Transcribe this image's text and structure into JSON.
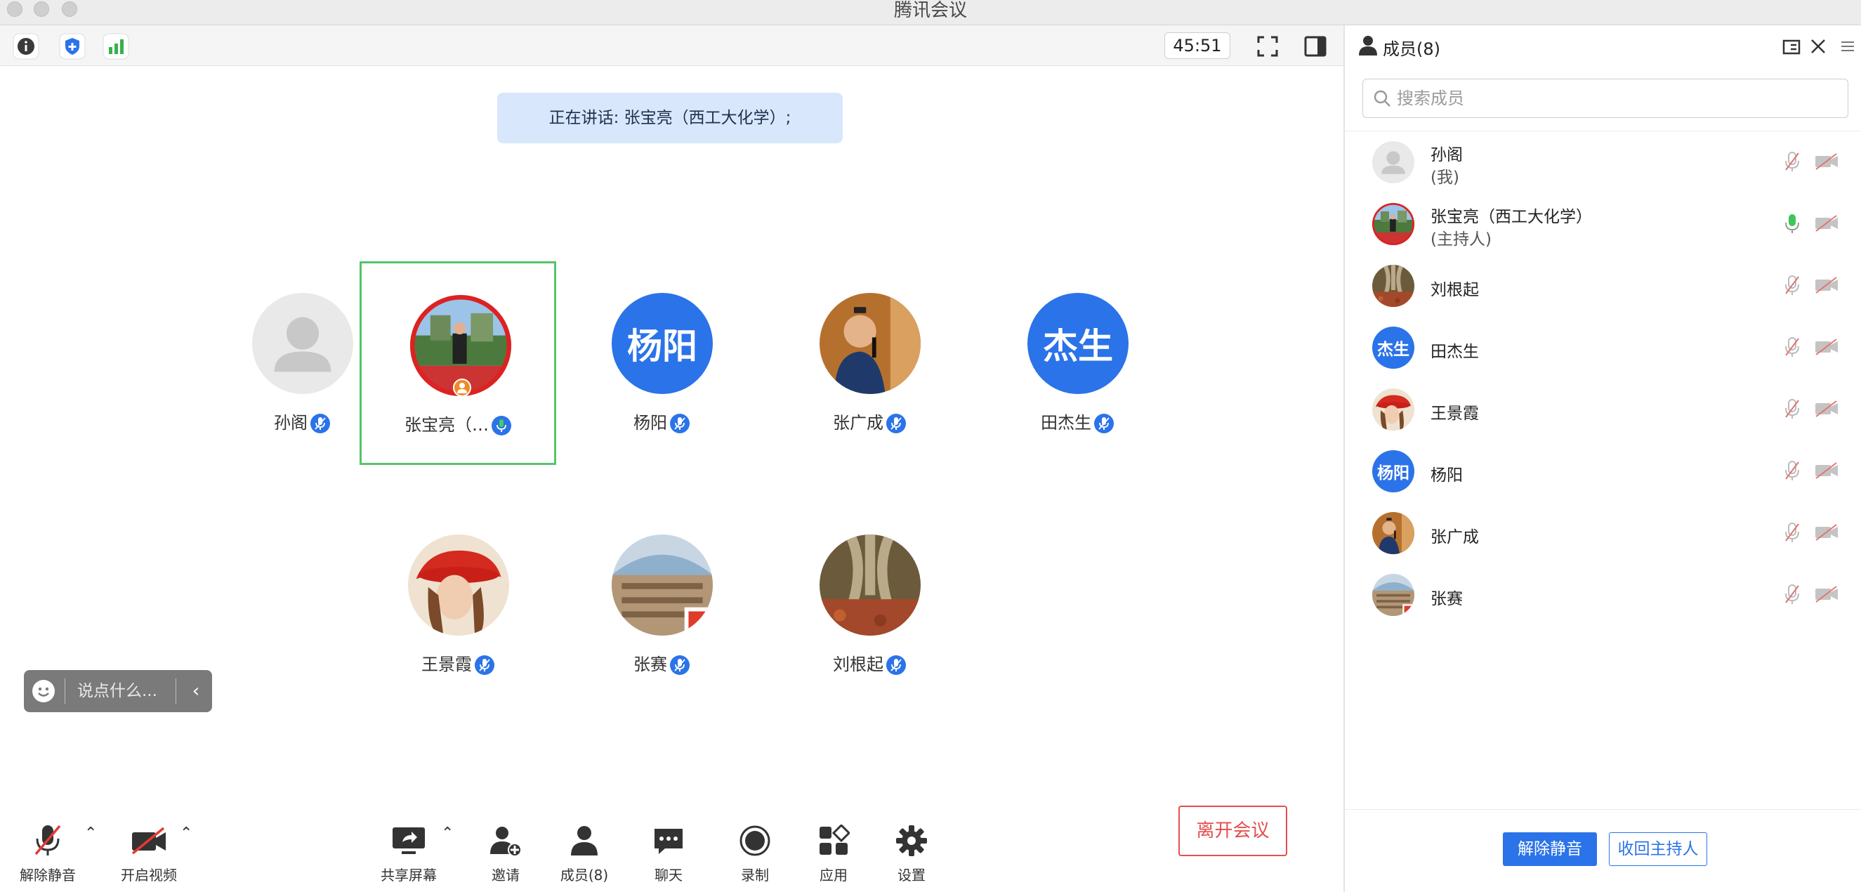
{
  "window": {
    "title": "腾讯会议"
  },
  "toolbar": {
    "timer": "45:51",
    "icons": [
      "info-icon",
      "shield-icon",
      "signal-icon",
      "fullscreen-icon",
      "panel-toggle-icon"
    ]
  },
  "speaker_banner": "正在讲话: 张宝亮（西工大化学）;",
  "tiles": [
    {
      "name": "孙阁",
      "avatar_text": "",
      "avatar_kind": "default",
      "mic": "muted"
    },
    {
      "name": "张宝亮（…",
      "avatar_text": "",
      "avatar_kind": "photo-landscape-person",
      "mic": "speaking",
      "active": true
    },
    {
      "name": "杨阳",
      "avatar_text": "杨阳",
      "avatar_kind": "text",
      "mic": "muted"
    },
    {
      "name": "张广成",
      "avatar_text": "",
      "avatar_kind": "photo-speaker",
      "mic": "muted"
    },
    {
      "name": "田杰生",
      "avatar_text": "杰生",
      "avatar_kind": "text",
      "mic": "muted"
    },
    {
      "name": "王景霞",
      "avatar_text": "",
      "avatar_kind": "photo-red-hat",
      "mic": "muted"
    },
    {
      "name": "张赛",
      "avatar_text": "",
      "avatar_kind": "photo-building",
      "mic": "muted"
    },
    {
      "name": "刘根起",
      "avatar_text": "",
      "avatar_kind": "photo-roots",
      "mic": "muted"
    }
  ],
  "chat": {
    "placeholder": "说点什么..."
  },
  "bottom_bar": {
    "unmute": "解除静音",
    "start_video": "开启视频",
    "share_screen": "共享屏幕",
    "invite": "邀请",
    "members": "成员(8)",
    "chat": "聊天",
    "record": "录制",
    "apps": "应用",
    "settings": "设置",
    "leave": "离开会议"
  },
  "panel": {
    "title": "成员(8)",
    "search_placeholder": "搜索成员",
    "members": [
      {
        "name": "孙阁",
        "sub": "(我)",
        "avatar_text": "",
        "mic": "muted"
      },
      {
        "name": "张宝亮（西工大化学）",
        "sub": "(主持人)",
        "avatar_text": "",
        "mic": "speaking"
      },
      {
        "name": "刘根起",
        "sub": "",
        "avatar_text": "",
        "mic": "muted"
      },
      {
        "name": "田杰生",
        "sub": "",
        "avatar_text": "杰生",
        "mic": "muted"
      },
      {
        "name": "王景霞",
        "sub": "",
        "avatar_text": "",
        "mic": "muted"
      },
      {
        "name": "杨阳",
        "sub": "",
        "avatar_text": "杨阳",
        "mic": "muted"
      },
      {
        "name": "张广成",
        "sub": "",
        "avatar_text": "",
        "mic": "muted"
      },
      {
        "name": "张赛",
        "sub": "",
        "avatar_text": "",
        "mic": "muted"
      }
    ],
    "footer": {
      "unmute": "解除静音",
      "revoke_host": "收回主持人"
    }
  },
  "colors": {
    "accent": "#2b73e8",
    "leave": "#e54e4e",
    "active_border": "#57c46c",
    "banner_bg": "#d8e7fb"
  }
}
